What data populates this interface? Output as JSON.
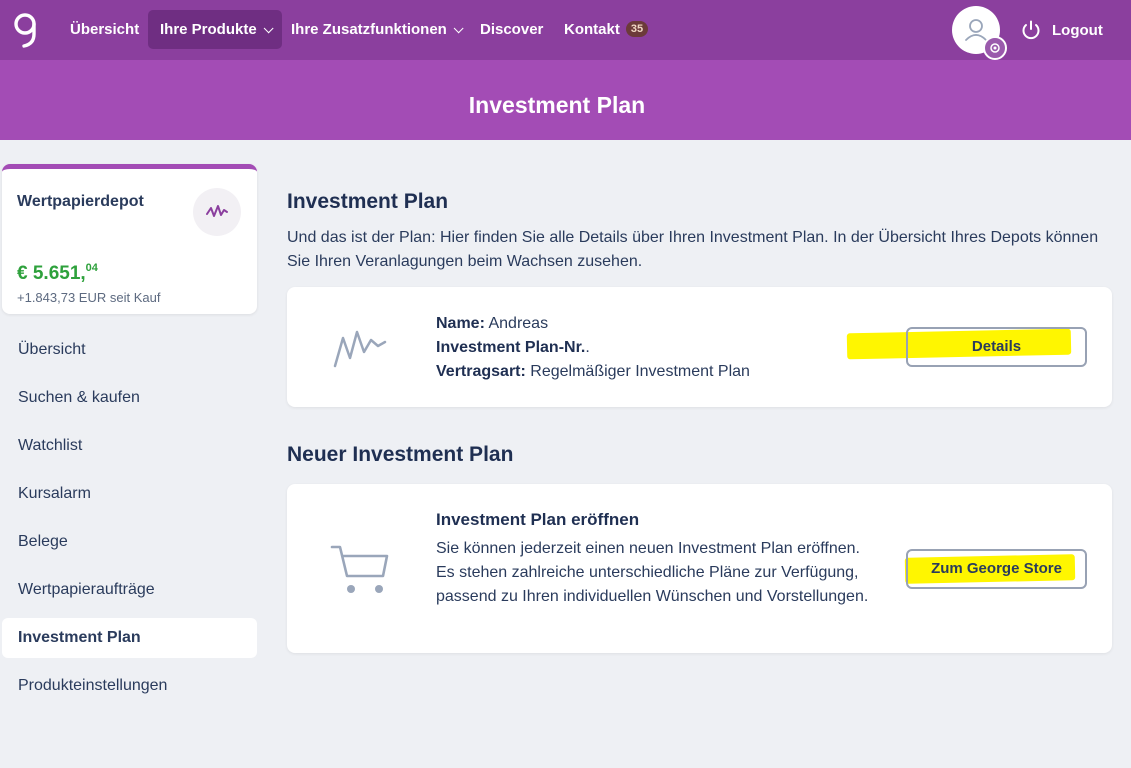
{
  "nav": {
    "items": [
      {
        "label": "Übersicht",
        "active": false,
        "dropdown": false
      },
      {
        "label": "Ihre Produkte",
        "active": true,
        "dropdown": true
      },
      {
        "label": "Ihre Zusatzfunktionen",
        "active": false,
        "dropdown": true
      },
      {
        "label": "Discover",
        "active": false,
        "dropdown": false
      },
      {
        "label": "Kontakt",
        "active": false,
        "dropdown": false,
        "badge": "35"
      }
    ],
    "logout_label": "Logout",
    "brand_color": "#8b3f9e",
    "accent_color": "#a34cb5"
  },
  "header": {
    "title": "Investment Plan"
  },
  "sidebar": {
    "depot": {
      "title": "Wertpapierdepot",
      "value_main": "€ 5.651,",
      "value_cents": "04",
      "change": "+1.843,73 EUR seit Kauf",
      "icon": "activity-icon"
    },
    "items": [
      {
        "label": "Übersicht",
        "active": false
      },
      {
        "label": "Suchen & kaufen",
        "active": false
      },
      {
        "label": "Watchlist",
        "active": false
      },
      {
        "label": "Kursalarm",
        "active": false
      },
      {
        "label": "Belege",
        "active": false
      },
      {
        "label": "Wertpapieraufträge",
        "active": false
      },
      {
        "label": "Investment Plan",
        "active": true
      },
      {
        "label": "Produkteinstellungen",
        "active": false
      }
    ]
  },
  "main": {
    "section1": {
      "title": "Investment Plan",
      "intro": "Und das ist der Plan: Hier finden Sie alle Details über Ihren Investment Plan. In der Übersicht Ihres Depots können Sie Ihren Veranlagungen beim Wachsen zusehen.",
      "plan": {
        "icon": "activity-line-icon",
        "name_label": "Name:",
        "name_value": "Andreas",
        "nr_label": "Investment Plan-Nr.",
        "nr_value": ".",
        "type_label": "Vertragsart:",
        "type_value": "Regelmäßiger Investment Plan",
        "button_label": "Details"
      }
    },
    "section2": {
      "title": "Neuer Investment Plan",
      "card": {
        "icon": "shopping-cart-icon",
        "title": "Investment Plan eröffnen",
        "text": "Sie können jederzeit einen neuen Investment Plan eröffnen. Es stehen zahlreiche unterschiedliche Pläne zur Verfügung, passend zu Ihren individuellen Wünschen und Vorstellungen.",
        "button_label": "Zum George Store"
      }
    }
  }
}
